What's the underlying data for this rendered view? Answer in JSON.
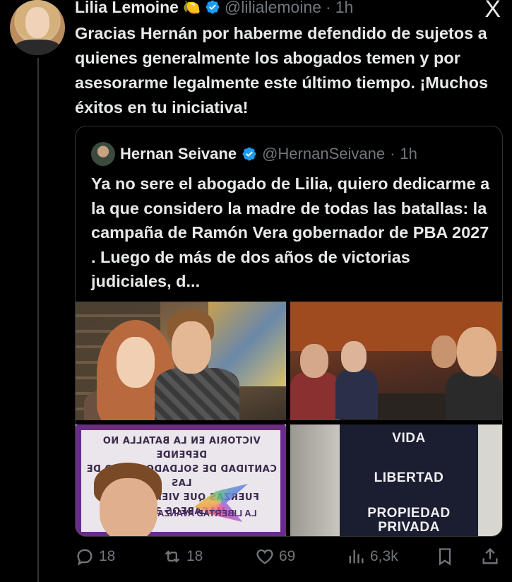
{
  "tweet": {
    "author_name": "Lilia Lemoine",
    "author_emoji": "🍋",
    "author_handle": "@lilialemoine",
    "separator": "·",
    "time": "1h",
    "text": "Gracias Hernán por haberme defendido de sujetos a quienes generalmente los abogados temen y por asesorarme legalmente este último tiempo. ¡Muchos éxitos en tu iniciativa!"
  },
  "close_label": "X",
  "quote": {
    "author_name": "Hernan Seivane",
    "author_handle": "@HernanSeivane",
    "separator": "·",
    "time": "1h",
    "text": "Ya no sere el abogado de Lilia, quiero dedicarme a la que considero la madre de todas las batallas: la campaña de Ramón Vera gobernador de PBA 2027 . Luego de más de dos años de victorias judiciales, d...",
    "photo3_sign": "VICTORIA EN LA BATALLA NO DEPENDE\nCANTIDAD DE SOLDADOS, SINO DE LAS\nFUERZAS QUE VIENEN DEL C\nMACABEOS 3:19",
    "photo3_logo": "LA LIBERTAD AVANZA",
    "photo4_words": [
      "VIDA",
      "LIBERTAD",
      "PROPIEDAD\nPRIVADA"
    ]
  },
  "actions": {
    "replies": "18",
    "reposts": "18",
    "likes": "69",
    "views": "6,3k"
  },
  "colors": {
    "background": "#000000",
    "text": "#e7e9ea",
    "muted": "#71767b",
    "verified": "#1d9bf0",
    "border": "#2f3336"
  }
}
